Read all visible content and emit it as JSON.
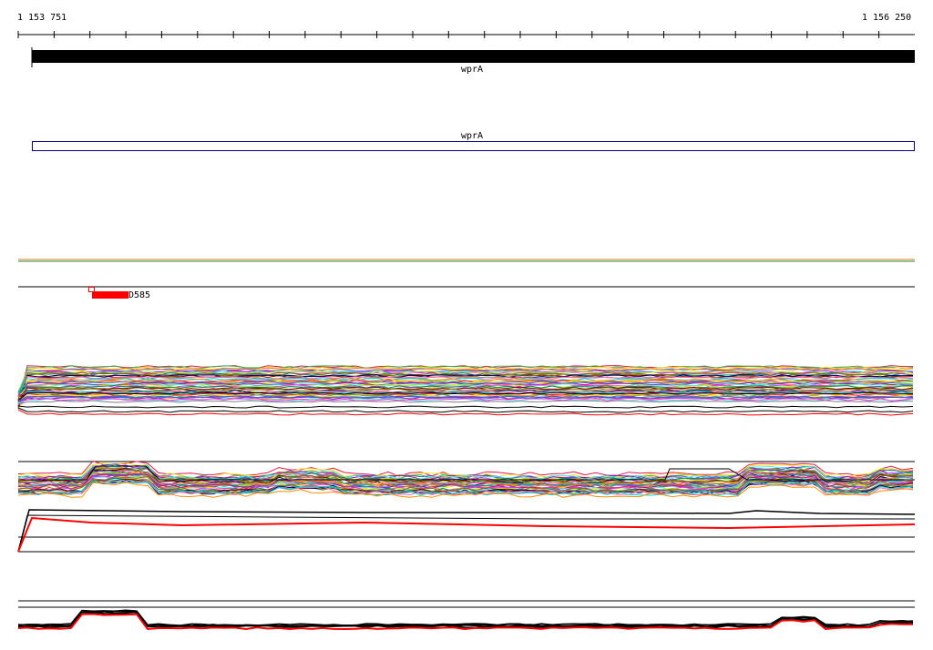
{
  "ruler": {
    "start_label": "1 153 751",
    "end_label": "1 156 250"
  },
  "tracks": {
    "gene": {
      "label": "wprA",
      "color": "#000000"
    },
    "cds": {
      "label": "wprA",
      "color": "#000080"
    },
    "feature": {
      "label": "D585",
      "color": "#ff0000"
    }
  },
  "colors": {
    "axis": "#000000",
    "highlight": "#ff0000",
    "divider_orange": "#d08020",
    "divider_green": "#308030"
  },
  "palette": [
    "#e6194b",
    "#3cb44b",
    "#ffe119",
    "#4363d8",
    "#f58231",
    "#911eb4",
    "#46f0f0",
    "#f032e6",
    "#bcf60c",
    "#008080",
    "#9a6324",
    "#800000",
    "#808000",
    "#000075",
    "#808080",
    "#ff69b4",
    "#00ced1",
    "#ff8c00"
  ]
}
